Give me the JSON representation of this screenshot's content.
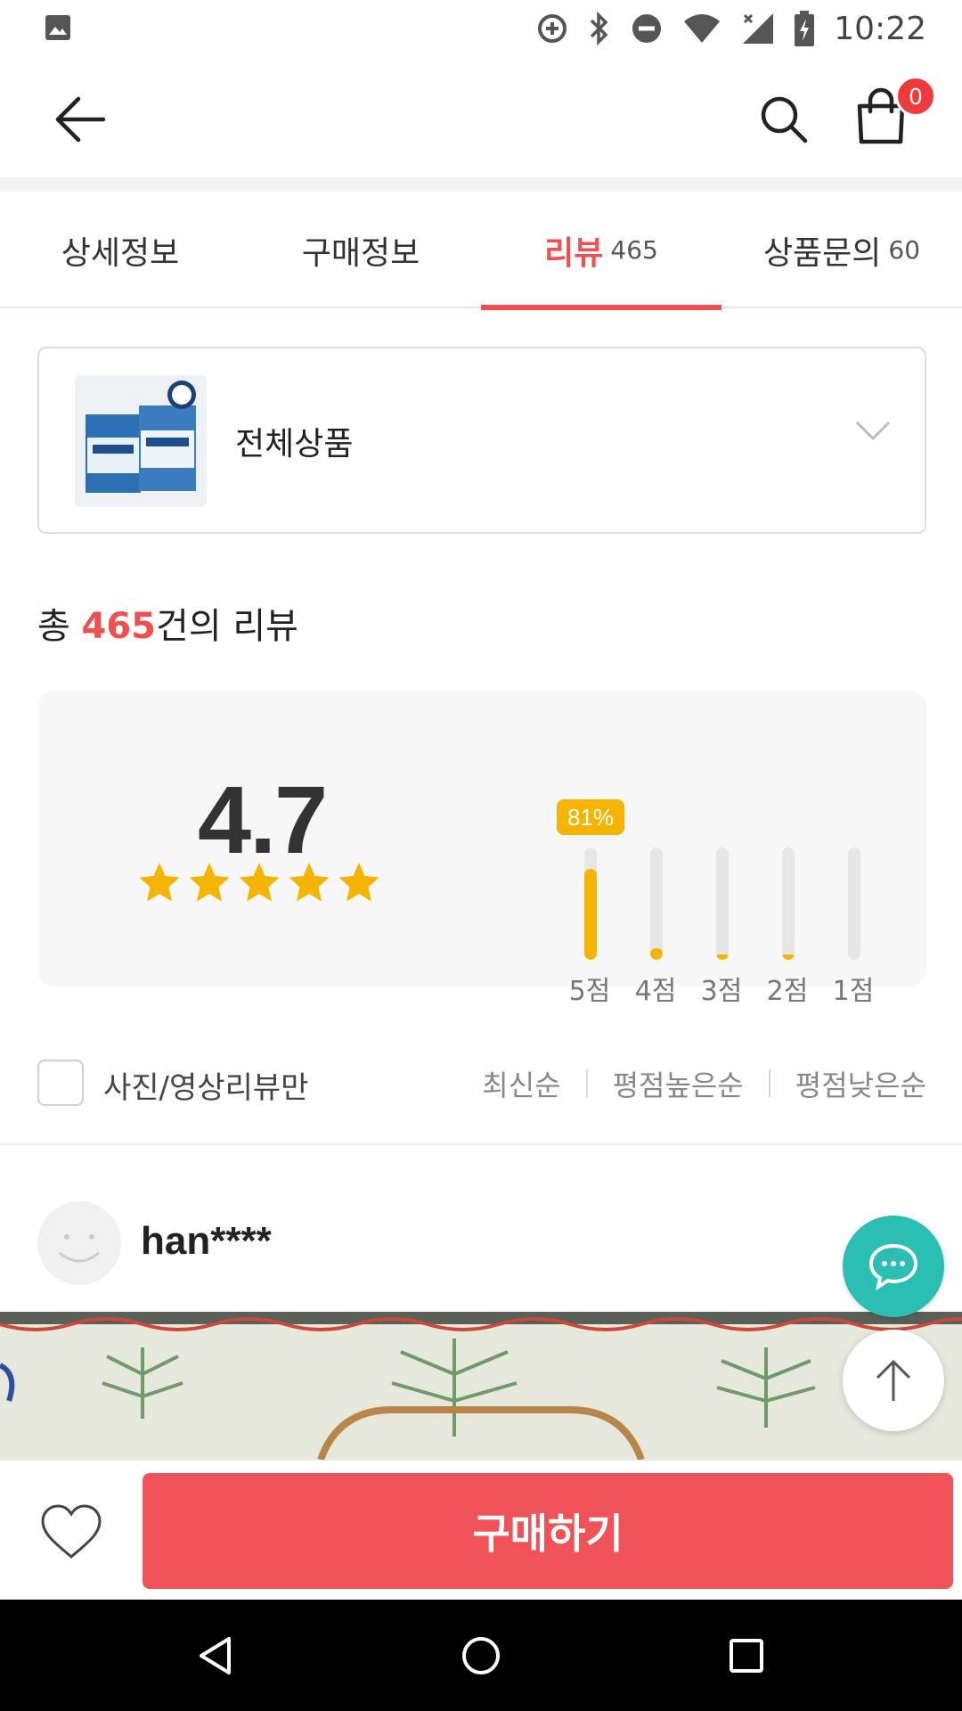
{
  "status_bar": {
    "time": "10:22",
    "icons": [
      "gallery-icon",
      "data-saver-icon",
      "bluetooth-icon",
      "do-not-disturb-icon",
      "wifi-icon",
      "signal-icon",
      "battery-charging-icon"
    ]
  },
  "header": {
    "back_icon": "arrow-left-icon",
    "search_icon": "search-icon",
    "cart_icon": "shopping-bag-icon",
    "cart_count": "0"
  },
  "tabs": [
    {
      "label": "상세정보",
      "count": ""
    },
    {
      "label": "구매정보",
      "count": ""
    },
    {
      "label": "리뷰",
      "count": "465",
      "active": true
    },
    {
      "label": "상품문의",
      "count": "60"
    }
  ],
  "product_select": {
    "label": "전체상품"
  },
  "summary": {
    "prefix": "총 ",
    "count": "465",
    "suffix": "건의 리뷰"
  },
  "rating": {
    "score": "4.7",
    "stars": 5,
    "distribution": [
      {
        "label": "5점",
        "fraction": 0.81,
        "badge": "81%"
      },
      {
        "label": "4점",
        "fraction": 0.1
      },
      {
        "label": "3점",
        "fraction": 0.02
      },
      {
        "label": "2점",
        "fraction": 0.01
      },
      {
        "label": "1점",
        "fraction": 0.0
      }
    ]
  },
  "filters": {
    "photo_only_label": "사진/영상리뷰만",
    "sort_options": [
      "최신순",
      "평점높은순",
      "평점낮은순"
    ]
  },
  "review": {
    "reviewer": "han****"
  },
  "bottom": {
    "buy_label": "구매하기"
  },
  "colors": {
    "accent": "#ee4f4f",
    "star": "#f5b400",
    "chat": "#2bbfb3",
    "buy": "#ef5257"
  }
}
